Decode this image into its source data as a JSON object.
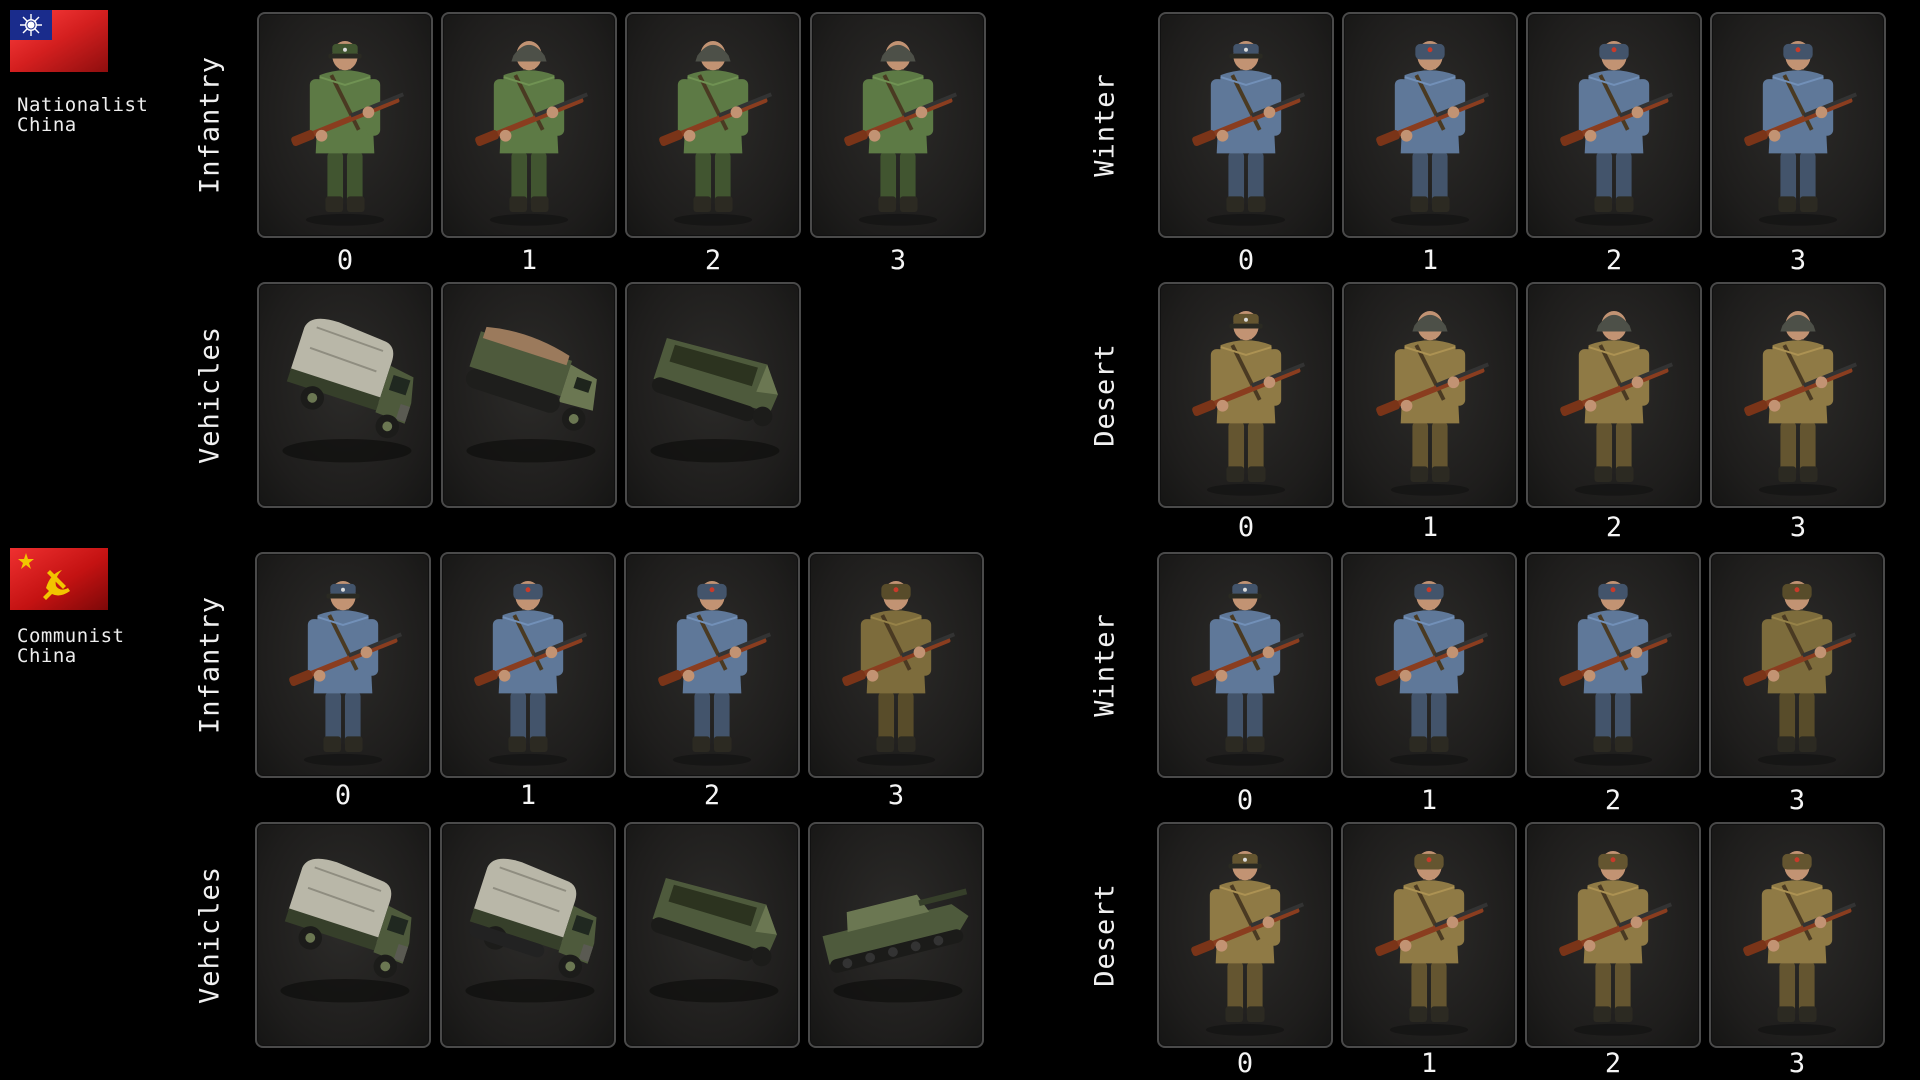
{
  "factions": [
    {
      "name": "Nationalist\nChina",
      "flag": "nationalist-china-flag-icon",
      "infantry": {
        "label": "Infantry",
        "variants": [
          "0",
          "1",
          "2",
          "3"
        ],
        "uniform": "#5d7a45",
        "headgear": [
          "peaked-cap",
          "helmet",
          "helmet",
          "helmet"
        ]
      },
      "vehicles": {
        "label": "Vehicles",
        "items": [
          "covered-truck-icon",
          "halftrack-truck-icon",
          "armored-halftrack-icon"
        ]
      },
      "winter": {
        "label": "Winter",
        "variants": [
          "0",
          "1",
          "2",
          "3"
        ],
        "uniform": "#5f7899"
      },
      "desert": {
        "label": "Desert",
        "variants": [
          "0",
          "1",
          "2",
          "3"
        ],
        "uniform": "#8f7a45"
      }
    },
    {
      "name": "Communist\nChina",
      "flag": "communist-china-flag-icon",
      "infantry": {
        "label": "Infantry",
        "variants": [
          "0",
          "1",
          "2",
          "3"
        ],
        "uniforms": [
          "#5f7899",
          "#5f7899",
          "#5f7899",
          "#7d6c3c"
        ]
      },
      "vehicles": {
        "label": "Vehicles",
        "items": [
          "covered-truck-icon",
          "covered-halftrack-truck-icon",
          "armored-halftrack-icon",
          "self-propelled-gun-icon"
        ]
      },
      "winter": {
        "label": "Winter",
        "variants": [
          "0",
          "1",
          "2",
          "3"
        ],
        "uniforms": [
          "#5f7899",
          "#5f7899",
          "#5f7899",
          "#7d6c3c"
        ]
      },
      "desert": {
        "label": "Desert",
        "variants": [
          "0",
          "1",
          "2",
          "3"
        ],
        "uniform": "#8f7a45"
      }
    }
  ],
  "colors": {
    "background": "#000000",
    "card_border": "#4a4a4a",
    "nationalist_flag_red": "#d41f1f",
    "nationalist_flag_blue": "#1a2c8c",
    "communist_flag_red": "#c41212",
    "communist_flag_gold": "#f2c500"
  }
}
